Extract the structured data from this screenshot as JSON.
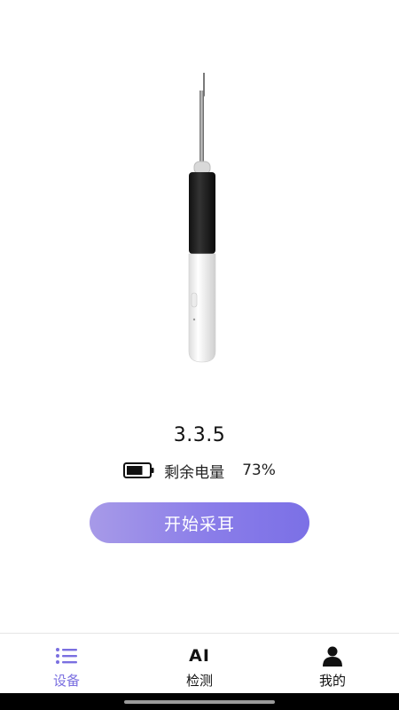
{
  "device": {
    "version": "3.3.5",
    "battery_label": "剩余电量",
    "battery_percent": "73%",
    "battery_level": 0.73
  },
  "actions": {
    "start_label": "开始采耳"
  },
  "tabbar": {
    "items": [
      {
        "label": "设备",
        "icon": "list-icon",
        "active": true
      },
      {
        "label": "检测",
        "icon": "ai-text-icon",
        "icon_text": "AI",
        "active": false
      },
      {
        "label": "我的",
        "icon": "person-icon",
        "active": false
      }
    ]
  },
  "colors": {
    "accent": "#7a6fe0",
    "button_gradient_start": "#a79ae8",
    "button_gradient_end": "#7b70e6"
  }
}
